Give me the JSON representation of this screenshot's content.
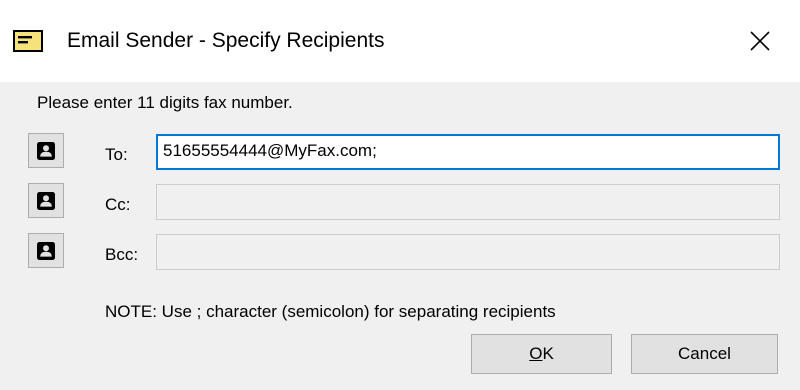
{
  "window": {
    "title": "Email Sender - Specify Recipients"
  },
  "form": {
    "instruction": "Please enter 11 digits fax number.",
    "to_label": "To:",
    "to_value": "51655554444@MyFax.com;",
    "cc_label": "Cc:",
    "cc_value": "",
    "bcc_label": "Bcc:",
    "bcc_value": "",
    "note": "NOTE: Use ; character (semicolon) for separating recipients"
  },
  "buttons": {
    "ok_mnemonic": "O",
    "ok_rest": "K",
    "cancel_label": "Cancel"
  },
  "icons": {
    "title": "email-icon",
    "close": "close-icon",
    "address_book": "contact-card-icon"
  },
  "colors": {
    "focus_border": "#0078d7",
    "dialog_bg": "#f0f0f0",
    "title_icon_fill": "#f6e27a"
  }
}
